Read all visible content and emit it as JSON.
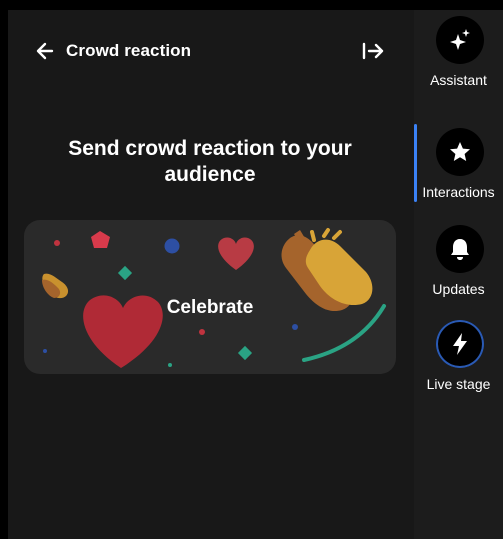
{
  "panel": {
    "title": "Crowd reaction",
    "heading": "Send crowd reaction to your audience",
    "back_icon": "arrow-left-icon",
    "collapse_icon": "collapse-panel-icon"
  },
  "reaction_card": {
    "label": "Celebrate",
    "icons": [
      "heart-icon",
      "clapping-hands-icon"
    ]
  },
  "sidebar": {
    "active_index": 1,
    "accent_color": "#3b82f6",
    "items": [
      {
        "label": "Assistant",
        "icon": "sparkle-icon"
      },
      {
        "label": "Interactions",
        "icon": "star-icon"
      },
      {
        "label": "Updates",
        "icon": "bell-icon"
      },
      {
        "label": "Live stage",
        "icon": "lightning-icon"
      }
    ]
  }
}
